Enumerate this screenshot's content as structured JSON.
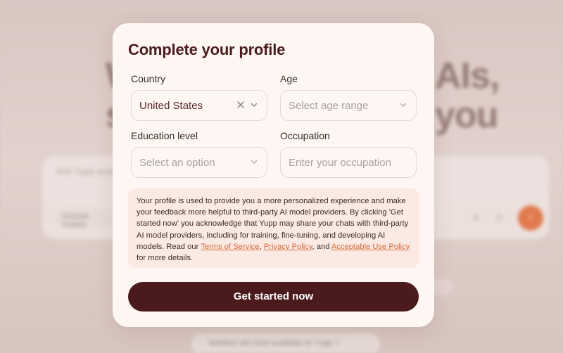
{
  "background": {
    "headline_left_1": "W",
    "headline_left_2": "s",
    "headline_right_1": "AIs,",
    "headline_right_2": "you",
    "chat_placeholder": "Ask Yupp anything...",
    "model_chip": "Choose models",
    "bottom_chip": "Whether tell more available on Yupp ?"
  },
  "modal": {
    "title": "Complete your profile",
    "country": {
      "label": "Country",
      "value": "United States"
    },
    "age": {
      "label": "Age",
      "placeholder": "Select age range"
    },
    "education": {
      "label": "Education level",
      "placeholder": "Select an option"
    },
    "occupation": {
      "label": "Occupation",
      "placeholder": "Enter your occupation"
    },
    "notice": {
      "text_1": "Your profile is used to provide you a more personalized experience and make your feedback more helpful to third-party AI model providers. By clicking 'Get started now' you acknowledge that Yupp may share your chats with third-party AI model providers, including for training, fine-tuning, and developing AI models. Read our ",
      "terms_link": "Terms of Service",
      "sep_1": ", ",
      "privacy_link": "Privacy Policy",
      "sep_2": ", and ",
      "aup_link": "Acceptable Use Policy",
      "text_2": " for more details."
    },
    "cta_label": "Get started now"
  },
  "colors": {
    "accent": "#4a1a1c",
    "link": "#d06a3a",
    "send_button": "#e07a4e"
  },
  "icons": [
    "close-icon",
    "chevron-down-icon",
    "send-icon",
    "attach-icon",
    "tool-icon"
  ]
}
